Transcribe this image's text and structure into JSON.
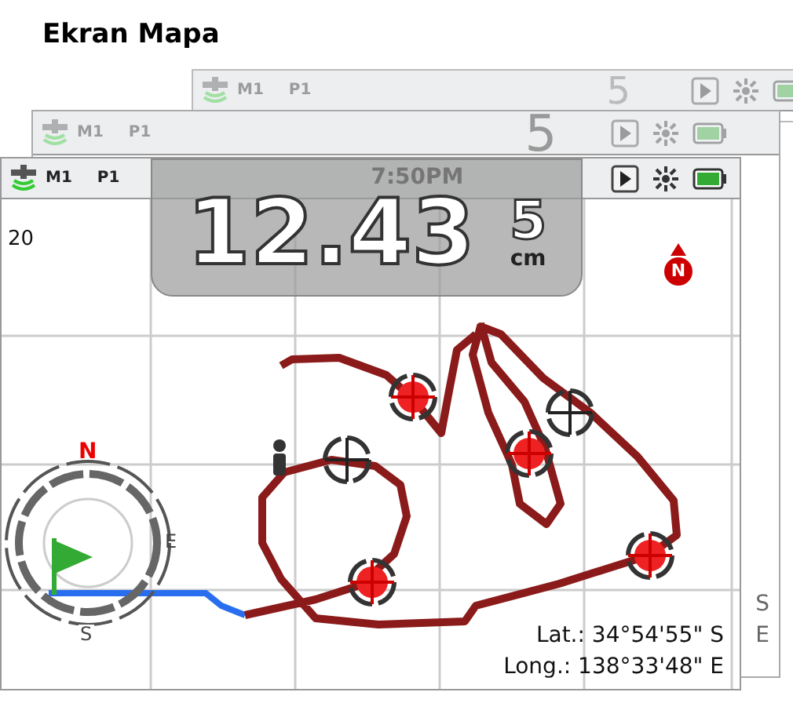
{
  "page_title": "Ekran Mapa",
  "screens": [
    {
      "kind": "back",
      "mode": "M1",
      "plot": "P1",
      "depth": "5"
    },
    {
      "kind": "middle",
      "mode": "M1",
      "plot": "P1",
      "depth": "5",
      "side_labels": [
        "S",
        "E"
      ]
    },
    {
      "kind": "front",
      "mode": "M1",
      "plot": "P1",
      "time": "7:50PM",
      "readout": "12.43",
      "depth": "5",
      "unit": "cm",
      "zoom": "20",
      "north_marker": "N",
      "compass": {
        "north": "N",
        "east": "E",
        "south": "S"
      },
      "latitude": "Lat.: 34°54'55\" S",
      "longitude": "Long.: 138°33'48\" E"
    }
  ]
}
